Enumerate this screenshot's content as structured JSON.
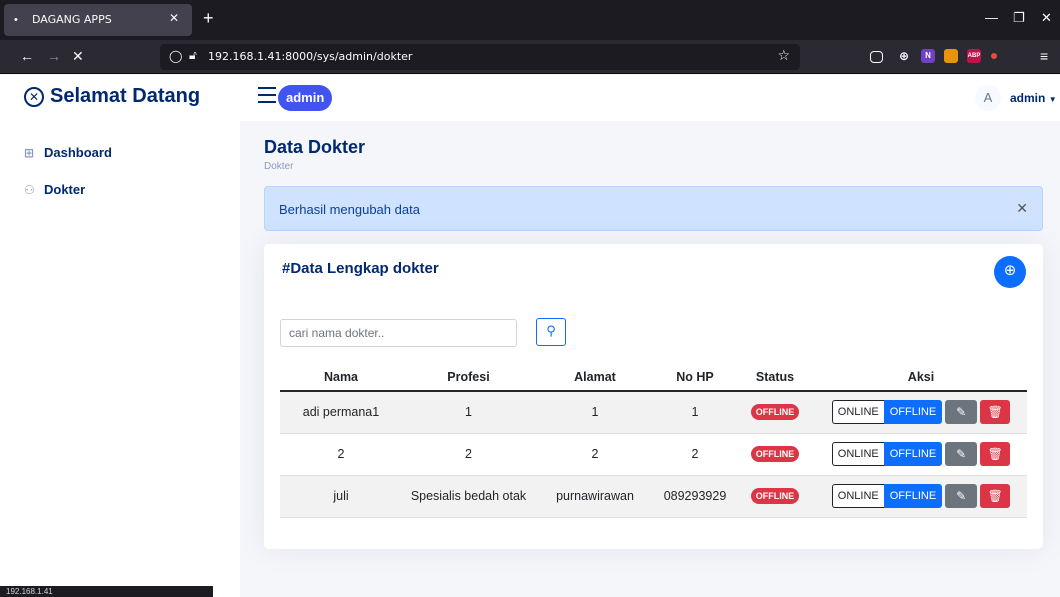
{
  "browser": {
    "tab_title": "DAGANG APPS",
    "url": "192.168.1.41:8000/sys/admin/dokter",
    "status_url": "192.168.1.41"
  },
  "header": {
    "brand": "Selamat Datang",
    "role_badge": "admin",
    "avatar_initial": "A",
    "user_name": "admin"
  },
  "sidebar": {
    "items": [
      {
        "label": "Dashboard",
        "icon": "grid-icon"
      },
      {
        "label": "Dokter",
        "icon": "people-icon"
      }
    ]
  },
  "main": {
    "page_title": "Data Dokter",
    "breadcrumb": "Dokter",
    "alert": "Berhasil mengubah data",
    "card_title": "#Data Lengkap dokter",
    "search_placeholder": "cari nama dokter..",
    "table": {
      "headers": [
        "Nama",
        "Profesi",
        "Alamat",
        "No HP",
        "Status",
        "Aksi"
      ],
      "rows": [
        {
          "nama": "adi permana1",
          "profesi": "1",
          "alamat": "1",
          "no_hp": "1",
          "status": "OFFLINE"
        },
        {
          "nama": "2",
          "profesi": "2",
          "alamat": "2",
          "no_hp": "2",
          "status": "OFFLINE"
        },
        {
          "nama": "juli",
          "profesi": "Spesialis bedah otak",
          "alamat": "purnawirawan",
          "no_hp": "089293929",
          "status": "OFFLINE"
        }
      ],
      "action_labels": {
        "online": "ONLINE",
        "offline": "OFFLINE"
      }
    }
  },
  "colors": {
    "brand": "#012970",
    "primary": "#0d6efd",
    "danger": "#dc3545",
    "secondary": "#6c757d",
    "alert_bg": "#cfe2ff"
  }
}
